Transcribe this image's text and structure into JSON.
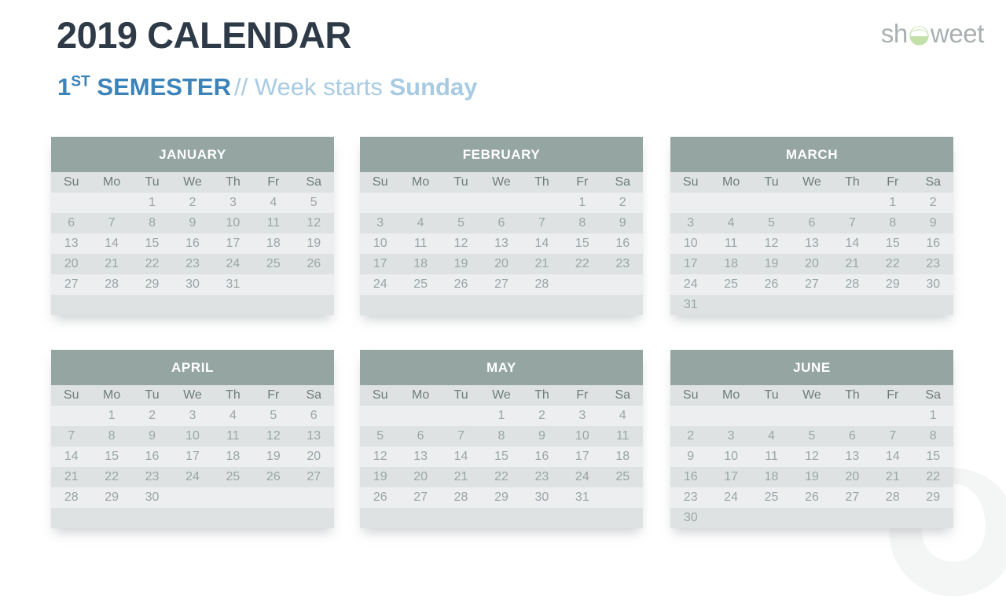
{
  "header": {
    "title": "2019 CALENDAR",
    "subtitle_semester": "1",
    "subtitle_semester_sup": "ST",
    "subtitle_semester_word": "SEMESTER",
    "subtitle_separator": "// Week starts",
    "subtitle_startday": "Sunday"
  },
  "logo": {
    "text_before": "sh",
    "mark": "showeet-circle-icon",
    "text_after": "weet"
  },
  "colors": {
    "title": "#2e3a47",
    "accent_blue": "#3b83b8",
    "accent_blue_light": "#a8cbe4",
    "month_header_bg": "#95a5a1",
    "row_light": "#edeef0",
    "row_dark": "#dfe2e2",
    "day_text": "#9aa5a5",
    "dow_text": "#6d7c7b",
    "logo_gray": "#a9b0b0",
    "logo_green": "#c3e0a8"
  },
  "weekdays": [
    "Su",
    "Mo",
    "Tu",
    "We",
    "Th",
    "Fr",
    "Sa"
  ],
  "months": [
    {
      "name": "JANUARY",
      "weeks": [
        [
          "",
          "",
          "1",
          "2",
          "3",
          "4",
          "5"
        ],
        [
          "6",
          "7",
          "8",
          "9",
          "10",
          "11",
          "12"
        ],
        [
          "13",
          "14",
          "15",
          "16",
          "17",
          "18",
          "19"
        ],
        [
          "20",
          "21",
          "22",
          "23",
          "24",
          "25",
          "26"
        ],
        [
          "27",
          "28",
          "29",
          "30",
          "31",
          "",
          ""
        ],
        [
          "",
          "",
          "",
          "",
          "",
          "",
          ""
        ]
      ]
    },
    {
      "name": "FEBRUARY",
      "weeks": [
        [
          "",
          "",
          "",
          "",
          "",
          "1",
          "2"
        ],
        [
          "3",
          "4",
          "5",
          "6",
          "7",
          "8",
          "9"
        ],
        [
          "10",
          "11",
          "12",
          "13",
          "14",
          "15",
          "16"
        ],
        [
          "17",
          "18",
          "19",
          "20",
          "21",
          "22",
          "23"
        ],
        [
          "24",
          "25",
          "26",
          "27",
          "28",
          "",
          ""
        ],
        [
          "",
          "",
          "",
          "",
          "",
          "",
          ""
        ]
      ]
    },
    {
      "name": "MARCH",
      "weeks": [
        [
          "",
          "",
          "",
          "",
          "",
          "1",
          "2"
        ],
        [
          "3",
          "4",
          "5",
          "6",
          "7",
          "8",
          "9"
        ],
        [
          "10",
          "11",
          "12",
          "13",
          "14",
          "15",
          "16"
        ],
        [
          "17",
          "18",
          "19",
          "20",
          "21",
          "22",
          "23"
        ],
        [
          "24",
          "25",
          "26",
          "27",
          "28",
          "29",
          "30"
        ],
        [
          "31",
          "",
          "",
          "",
          "",
          "",
          ""
        ]
      ]
    },
    {
      "name": "APRIL",
      "weeks": [
        [
          "",
          "1",
          "2",
          "3",
          "4",
          "5",
          "6"
        ],
        [
          "7",
          "8",
          "9",
          "10",
          "11",
          "12",
          "13"
        ],
        [
          "14",
          "15",
          "16",
          "17",
          "18",
          "19",
          "20"
        ],
        [
          "21",
          "22",
          "23",
          "24",
          "25",
          "26",
          "27"
        ],
        [
          "28",
          "29",
          "30",
          "",
          "",
          "",
          ""
        ],
        [
          "",
          "",
          "",
          "",
          "",
          "",
          ""
        ]
      ]
    },
    {
      "name": "MAY",
      "weeks": [
        [
          "",
          "",
          "",
          "1",
          "2",
          "3",
          "4"
        ],
        [
          "5",
          "6",
          "7",
          "8",
          "9",
          "10",
          "11"
        ],
        [
          "12",
          "13",
          "14",
          "15",
          "16",
          "17",
          "18"
        ],
        [
          "19",
          "20",
          "21",
          "22",
          "23",
          "24",
          "25"
        ],
        [
          "26",
          "27",
          "28",
          "29",
          "30",
          "31",
          ""
        ],
        [
          "",
          "",
          "",
          "",
          "",
          "",
          ""
        ]
      ]
    },
    {
      "name": "JUNE",
      "weeks": [
        [
          "",
          "",
          "",
          "",
          "",
          "",
          "1"
        ],
        [
          "2",
          "3",
          "4",
          "5",
          "6",
          "7",
          "8"
        ],
        [
          "9",
          "10",
          "11",
          "12",
          "13",
          "14",
          "15"
        ],
        [
          "16",
          "17",
          "18",
          "19",
          "20",
          "21",
          "22"
        ],
        [
          "23",
          "24",
          "25",
          "26",
          "27",
          "28",
          "29"
        ],
        [
          "30",
          "",
          "",
          "",
          "",
          "",
          ""
        ]
      ]
    }
  ]
}
